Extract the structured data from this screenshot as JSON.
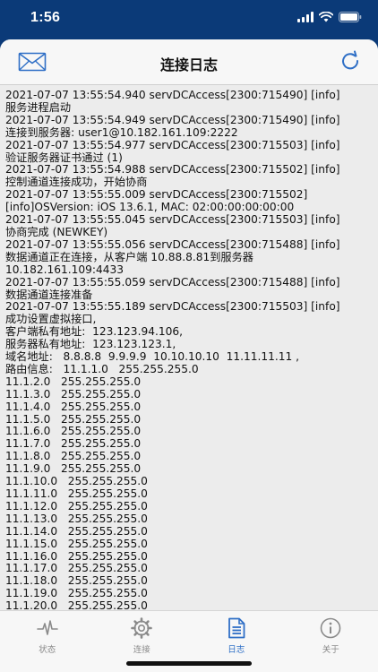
{
  "status_bar": {
    "time": "1:56"
  },
  "nav": {
    "title": "连接日志"
  },
  "icons": {
    "mail": "mail-icon",
    "refresh": "refresh-icon"
  },
  "log_lines": [
    "2021-07-07 13:55:54.940 servDCAccess[2300:715490] [info]",
    "服务进程启动",
    "2021-07-07 13:55:54.949 servDCAccess[2300:715490] [info]",
    "连接到服务器: user1@10.182.161.109:2222",
    "2021-07-07 13:55:54.977 servDCAccess[2300:715503] [info]",
    "验证服务器证书通过 (1)",
    "2021-07-07 13:55:54.988 servDCAccess[2300:715502] [info]",
    "控制通道连接成功，开始协商",
    "2021-07-07 13:55:55.009 servDCAccess[2300:715502]",
    "[info]OSVersion: iOS 13.6.1, MAC: 02:00:00:00:00:00",
    "2021-07-07 13:55:55.045 servDCAccess[2300:715503] [info]",
    "协商完成 (NEWKEY)",
    "2021-07-07 13:55:55.056 servDCAccess[2300:715488] [info]",
    "数据通道正在连接，从客户端 10.88.8.81到服务器",
    "10.182.161.109:4433",
    "2021-07-07 13:55:55.059 servDCAccess[2300:715488] [info]",
    "数据通道连接准备",
    "2021-07-07 13:55:55.189 servDCAccess[2300:715503] [info]",
    "成功设置虚拟接口,",
    "客户端私有地址:  123.123.94.106,",
    "服务器私有地址:  123.123.123.1,",
    "域名地址:   8.8.8.8  9.9.9.9  10.10.10.10  11.11.11.11 ,",
    "路由信息:   11.1.1.0   255.255.255.0",
    "11.1.2.0   255.255.255.0",
    "11.1.3.0   255.255.255.0",
    "11.1.4.0   255.255.255.0",
    "11.1.5.0   255.255.255.0",
    "11.1.6.0   255.255.255.0",
    "11.1.7.0   255.255.255.0",
    "11.1.8.0   255.255.255.0",
    "11.1.9.0   255.255.255.0",
    "11.1.10.0   255.255.255.0",
    "11.1.11.0   255.255.255.0",
    "11.1.12.0   255.255.255.0",
    "11.1.13.0   255.255.255.0",
    "11.1.14.0   255.255.255.0",
    "11.1.15.0   255.255.255.0",
    "11.1.16.0   255.255.255.0",
    "11.1.17.0   255.255.255.0",
    "11.1.18.0   255.255.255.0",
    "11.1.19.0   255.255.255.0",
    "11.1.20.0   255.255.255.0"
  ],
  "tabs": [
    {
      "label": "状态",
      "icon": "pulse-icon",
      "active": false
    },
    {
      "label": "连接",
      "icon": "gear-icon",
      "active": false
    },
    {
      "label": "日志",
      "icon": "document-icon",
      "active": true
    },
    {
      "label": "关于",
      "icon": "info-icon",
      "active": false
    }
  ],
  "colors": {
    "header_background": "#0b3a78",
    "accent": "#2f6fc6",
    "inactive": "#8a8a8a"
  }
}
